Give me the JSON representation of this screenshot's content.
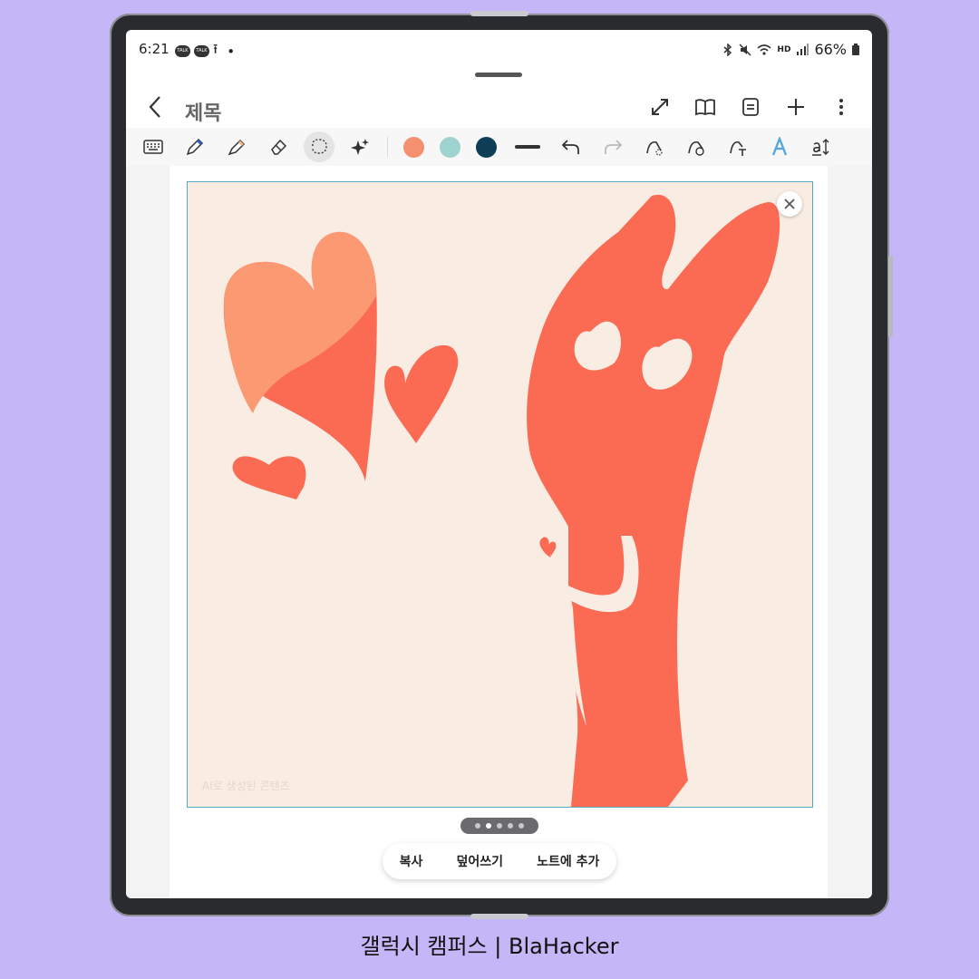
{
  "status_bar": {
    "time": "6:21",
    "notif_labels": [
      "TALK",
      "TALK"
    ],
    "dot": "•",
    "signal_label": "HD",
    "battery": "66%"
  },
  "title_bar": {
    "title": "제목"
  },
  "toolbar": {
    "colors": [
      "#f4906f",
      "#9fd3d0",
      "#0d3e55"
    ]
  },
  "image": {
    "watermark": "AI로 생성된 콘텐츠"
  },
  "pager": {
    "count": 5,
    "active_index": 1
  },
  "actions": {
    "copy": "복사",
    "overwrite": "덮어쓰기",
    "add_to_note": "노트에 추가"
  },
  "caption": "갤럭시 캠퍼스 | BlaHacker"
}
